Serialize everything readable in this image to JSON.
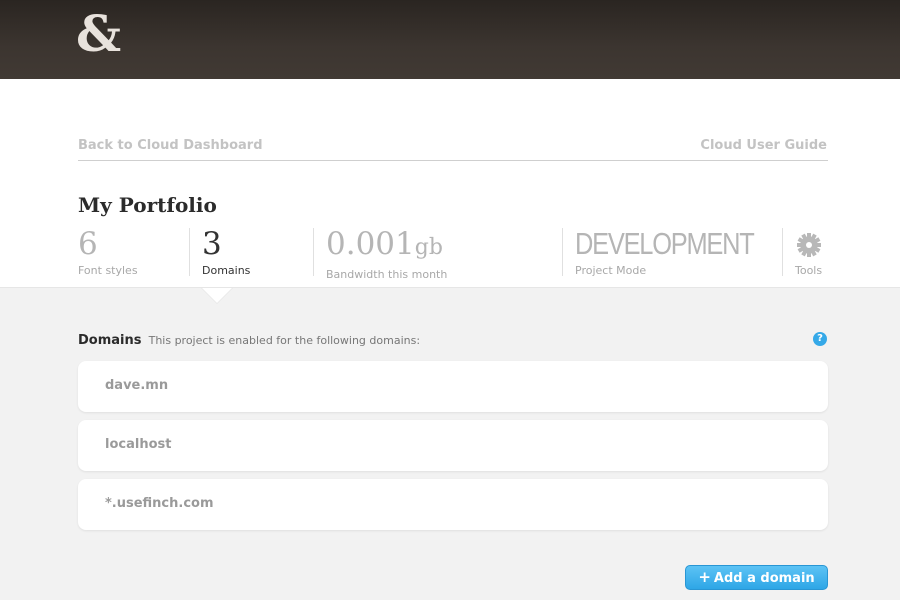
{
  "header": {
    "logo_text": "&"
  },
  "nav": {
    "back_link": "Back to Cloud Dashboard",
    "guide_link": "Cloud User Guide"
  },
  "project": {
    "title": "My Portfolio",
    "stats": {
      "font_styles": {
        "value": "6",
        "label": "Font styles"
      },
      "domains": {
        "value": "3",
        "label": "Domains"
      },
      "bandwidth": {
        "value": "0.001",
        "unit": "gb",
        "label": "Bandwidth this month"
      },
      "mode": {
        "value": "DEVELOPMENT",
        "label": "Project Mode"
      },
      "tools": {
        "label": "Tools",
        "icon": "gear-icon"
      }
    }
  },
  "domains": {
    "heading": "Domains",
    "description": "This project is enabled for the following domains:",
    "help_icon": "?",
    "items": [
      "dave.mn",
      "localhost",
      "*.usefinch.com"
    ],
    "add_button": {
      "icon": "+",
      "label": "Add a domain"
    }
  },
  "colors": {
    "accent": "#35a9e8",
    "header_bg": "#3c3530"
  }
}
